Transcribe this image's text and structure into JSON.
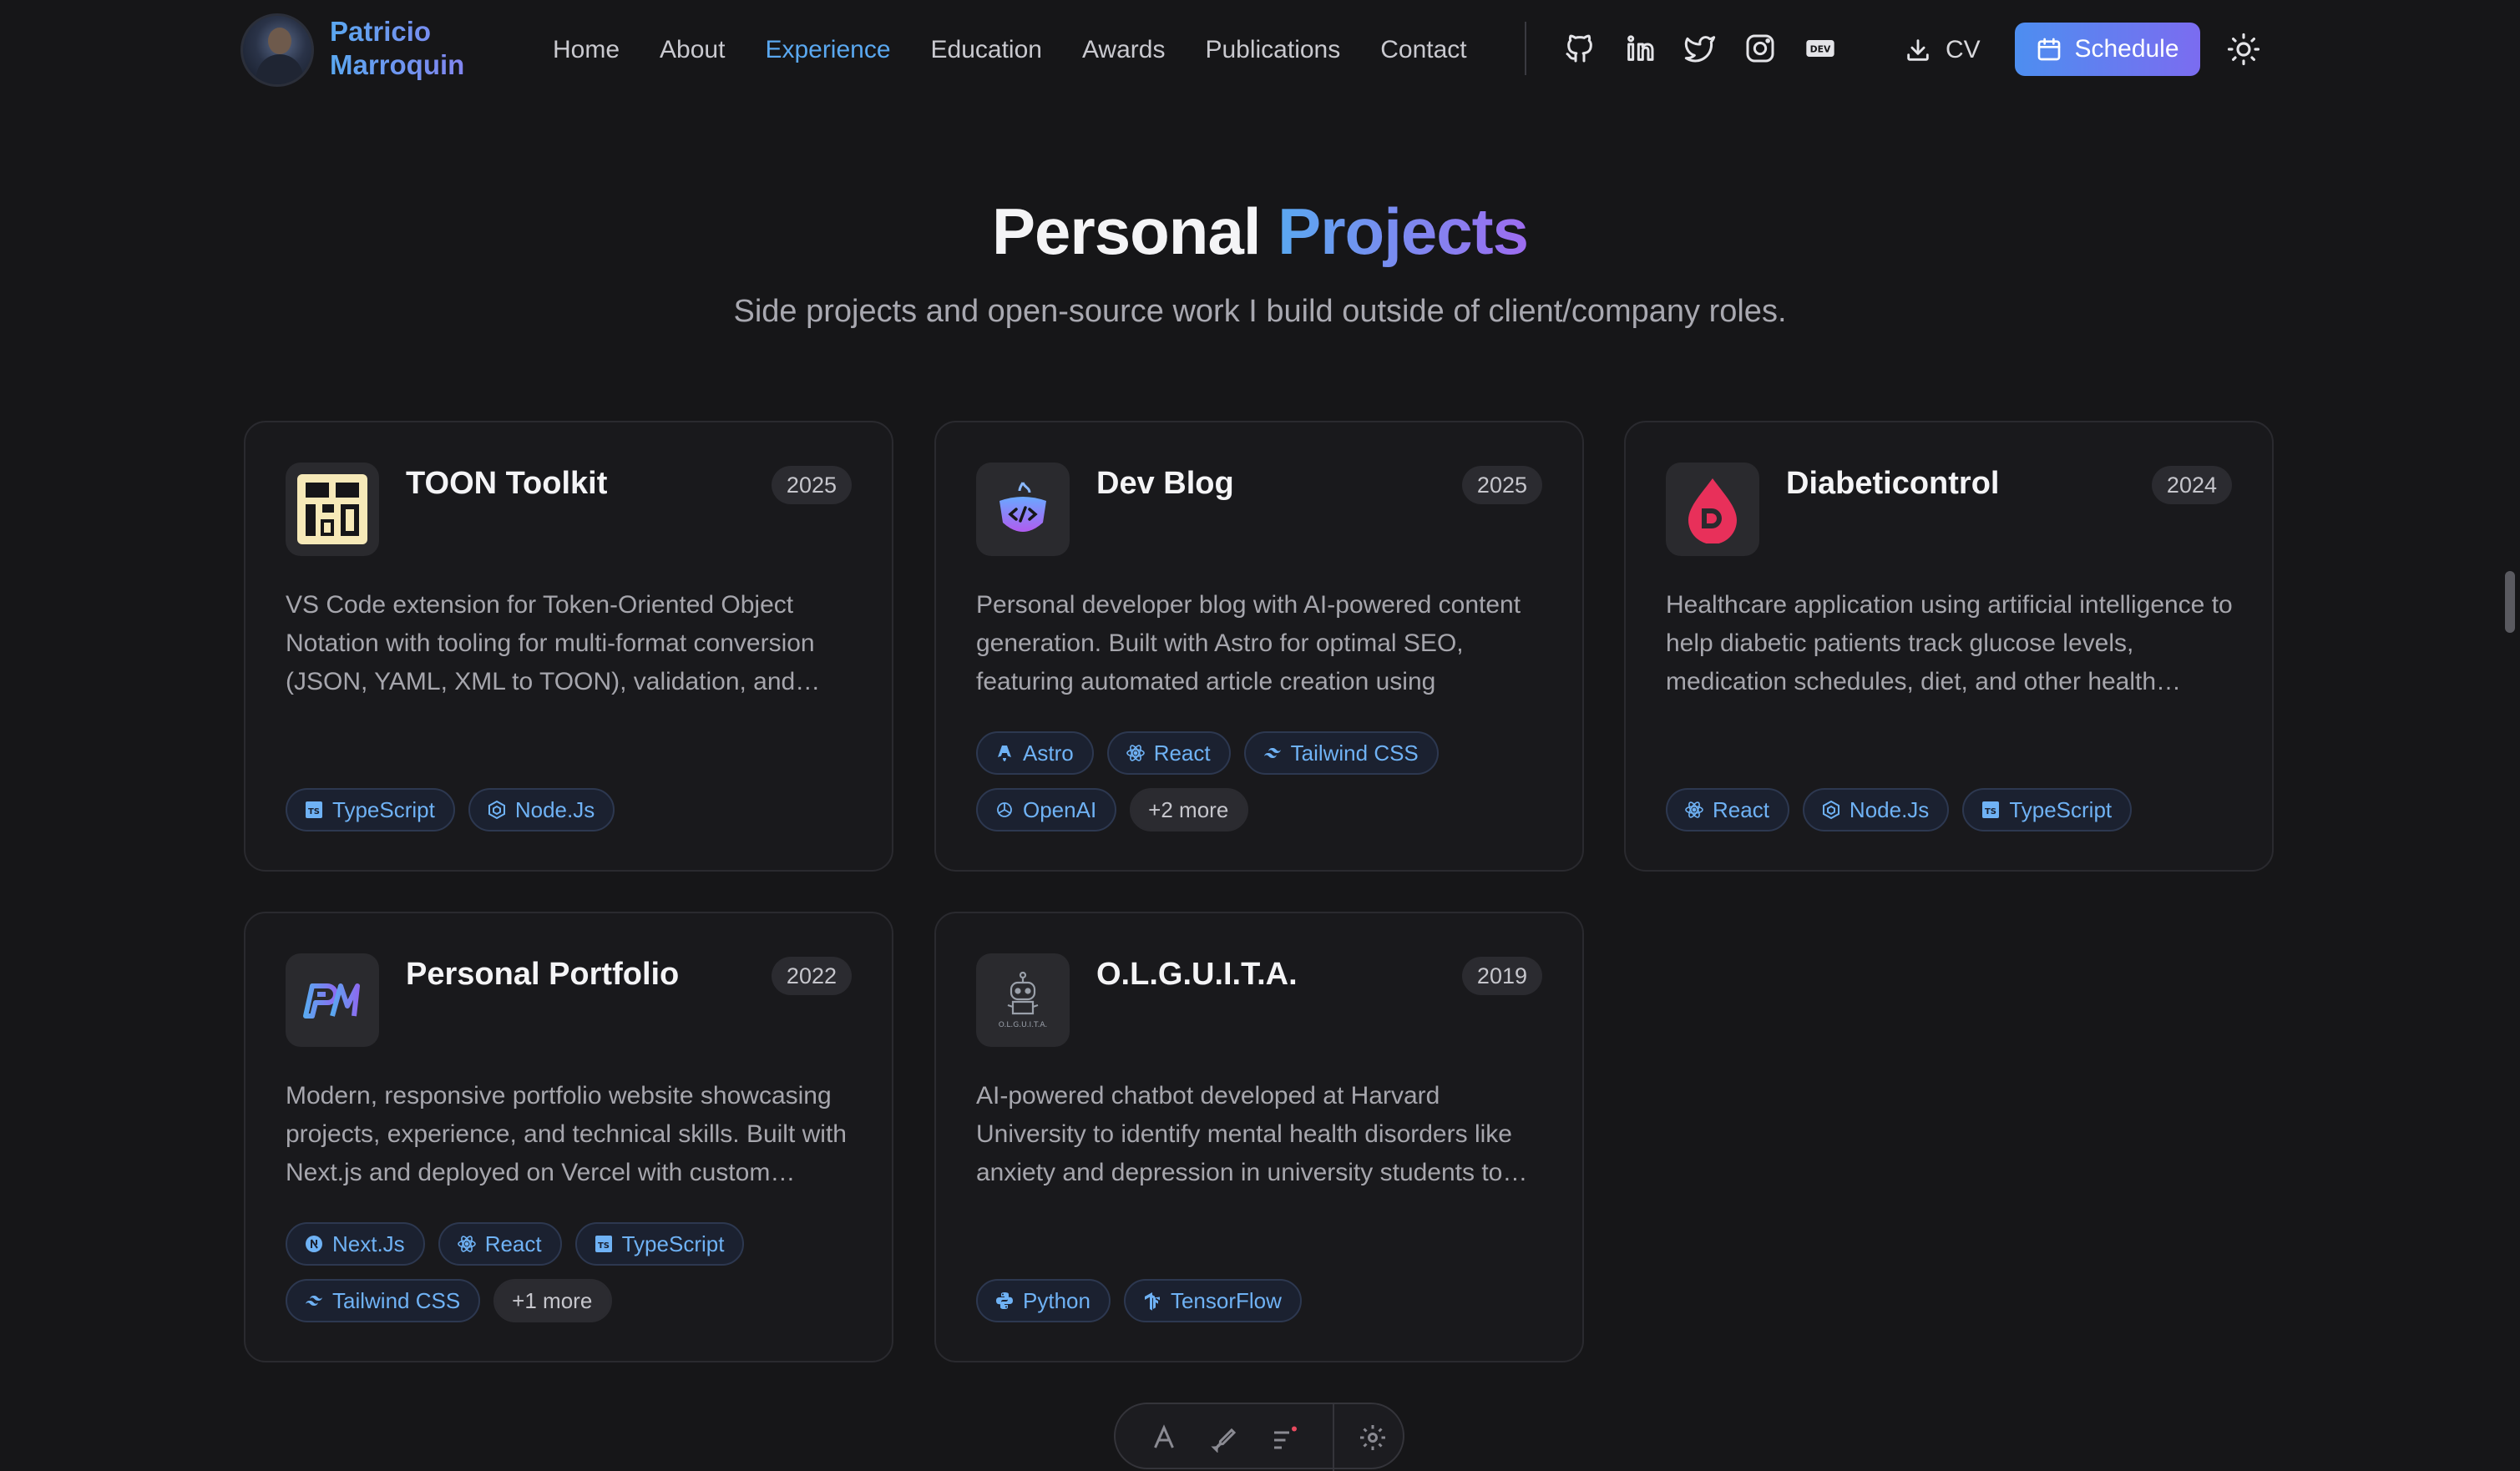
{
  "nav": {
    "brand_line1": "Patricio",
    "brand_line2": "Marroquin",
    "links": [
      {
        "label": "Home",
        "active": false
      },
      {
        "label": "About",
        "active": false
      },
      {
        "label": "Experience",
        "active": true
      },
      {
        "label": "Education",
        "active": false
      },
      {
        "label": "Awards",
        "active": false
      },
      {
        "label": "Publications",
        "active": false
      },
      {
        "label": "Contact",
        "active": false
      }
    ],
    "social_icons": [
      "github-icon",
      "linkedin-icon",
      "twitter-icon",
      "instagram-icon",
      "dev-icon"
    ],
    "cv_label": "CV",
    "schedule_label": "Schedule"
  },
  "section": {
    "title_main": "Personal",
    "title_accent": "Projects",
    "subtitle": "Side projects and open-source work I build outside of client/company roles."
  },
  "projects": [
    {
      "title": "TOON Toolkit",
      "year": "2025",
      "logo": "toon-logo",
      "description": "VS Code extension for Token-Oriented Object Notation with tooling for multi-format conversion (JSON, YAML, XML to TOON), validation, and…",
      "tags": [
        "TypeScript",
        "Node.Js"
      ],
      "more": ""
    },
    {
      "title": "Dev Blog",
      "year": "2025",
      "logo": "devblog-logo",
      "description": "Personal developer blog with AI-powered content generation. Built with Astro for optimal SEO, featuring automated article creation using OpenAI…",
      "tags": [
        "Astro",
        "React",
        "Tailwind CSS",
        "OpenAI"
      ],
      "more": "+2 more"
    },
    {
      "title": "Diabeticontrol",
      "year": "2024",
      "logo": "diabeticontrol-logo",
      "description": "Healthcare application using artificial intelligence to help diabetic patients track glucose levels, medication schedules, diet, and other health…",
      "tags": [
        "React",
        "Node.Js",
        "TypeScript"
      ],
      "more": ""
    },
    {
      "title": "Personal Portfolio",
      "year": "2022",
      "logo": "portfolio-logo",
      "description": "Modern, responsive portfolio website showcasing projects, experience, and technical skills. Built with Next.js and deployed on Vercel with custom…",
      "tags": [
        "Next.Js",
        "React",
        "TypeScript",
        "Tailwind CSS"
      ],
      "more": "+1 more"
    },
    {
      "title": "O.L.G.U.I.T.A.",
      "year": "2019",
      "logo": "olguita-logo",
      "description": "AI-powered chatbot developed at Harvard University to identify mental health disorders like anxiety and depression in university students to…",
      "tags": [
        "Python",
        "TensorFlow"
      ],
      "more": ""
    }
  ],
  "colors": {
    "accent_blue": "#5aa8f0",
    "accent_purple": "#8b7cf0",
    "background": "#161618",
    "card": "#19191c"
  }
}
